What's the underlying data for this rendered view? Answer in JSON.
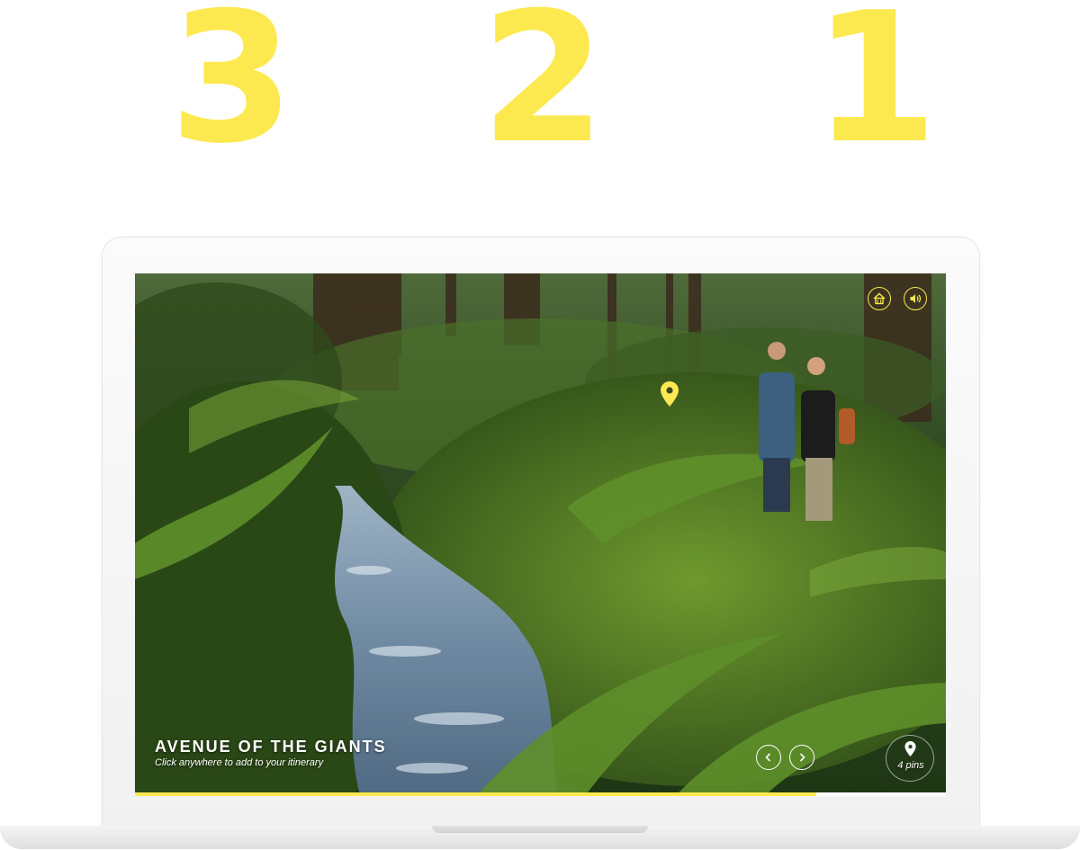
{
  "countdown": {
    "digits": [
      "3",
      "2",
      "1"
    ]
  },
  "colors": {
    "accent": "#FCE94F",
    "text": "#FFFFFF"
  },
  "player": {
    "title": "AVENUE OF THE GIANTS",
    "subtitle": "Click anywhere to add to your itinerary",
    "pins_label": "4 pins",
    "progress": 0.84,
    "icons": {
      "home": "home-icon",
      "sound": "speaker-icon",
      "prev": "chevron-left-icon",
      "next": "chevron-right-icon",
      "pin": "map-pin-icon"
    }
  }
}
